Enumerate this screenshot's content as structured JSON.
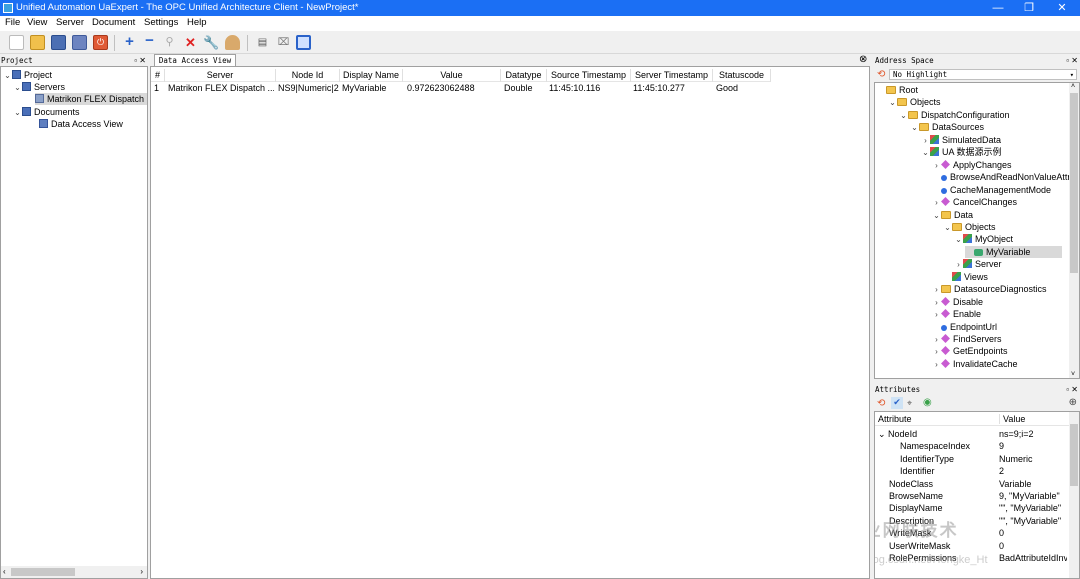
{
  "window": {
    "title": "Unified Automation UaExpert - The OPC Unified Architecture Client - NewProject*",
    "min": "—",
    "max": "❐",
    "close": "✕"
  },
  "menu": [
    "File",
    "View",
    "Server",
    "Document",
    "Settings",
    "Help"
  ],
  "project_panel": {
    "header": "Project",
    "items": [
      {
        "label": "Project",
        "level": 0,
        "expanded": true,
        "icon": "project-icon"
      },
      {
        "label": "Servers",
        "level": 1,
        "expanded": true,
        "icon": "servers-folder-icon"
      },
      {
        "label": "Matrikon FLEX Dispatch",
        "level": 2,
        "icon": "server-icon",
        "selected": true
      },
      {
        "label": "Documents",
        "level": 1,
        "expanded": true,
        "icon": "documents-folder-icon"
      },
      {
        "label": "Data Access View",
        "level": 2,
        "icon": "document-icon"
      }
    ]
  },
  "data_access_view": {
    "tab_label": "Data Access View",
    "columns": [
      "#",
      "Server",
      "Node Id",
      "Display Name",
      "Value",
      "Datatype",
      "Source Timestamp",
      "Server Timestamp",
      "Statuscode"
    ],
    "rows": [
      [
        "1",
        "Matrikon FLEX Dispatch ...",
        "NS9|Numeric|2",
        "MyVariable",
        "0.972623062488",
        "Double",
        "11:45:10.116",
        "11:45:10.277",
        "Good"
      ]
    ]
  },
  "address_space": {
    "header": "Address Space",
    "highlight": "No Highlight",
    "nodes": [
      {
        "label": "Root",
        "level": 0,
        "arrow": "",
        "icon": "folder"
      },
      {
        "label": "Objects",
        "level": 1,
        "arrow": "v",
        "icon": "folder"
      },
      {
        "label": "DispatchConfiguration",
        "level": 2,
        "arrow": "v",
        "icon": "folder"
      },
      {
        "label": "DataSources",
        "level": 3,
        "arrow": "v",
        "icon": "folder"
      },
      {
        "label": "SimulatedData",
        "level": 4,
        "arrow": ">",
        "icon": "obj"
      },
      {
        "label": "UA 数据源示例",
        "level": 4,
        "arrow": "v",
        "icon": "obj"
      },
      {
        "label": "ApplyChanges",
        "level": 5,
        "arrow": ">",
        "icon": "meth"
      },
      {
        "label": "BrowseAndReadNonValueAttri",
        "level": 5,
        "arrow": "",
        "icon": "var"
      },
      {
        "label": "CacheManagementMode",
        "level": 5,
        "arrow": "",
        "icon": "var"
      },
      {
        "label": "CancelChanges",
        "level": 5,
        "arrow": ">",
        "icon": "meth"
      },
      {
        "label": "Data",
        "level": 5,
        "arrow": "v",
        "icon": "folder"
      },
      {
        "label": "Objects",
        "level": 6,
        "arrow": "v",
        "icon": "folder"
      },
      {
        "label": "MyObject",
        "level": 7,
        "arrow": "v",
        "icon": "obj"
      },
      {
        "label": "MyVariable",
        "level": 8,
        "arrow": "",
        "icon": "varg",
        "selected": true
      },
      {
        "label": "Server",
        "level": 7,
        "arrow": ">",
        "icon": "obj"
      },
      {
        "label": "Views",
        "level": 6,
        "arrow": "",
        "icon": "obj"
      },
      {
        "label": "DatasourceDiagnostics",
        "level": 5,
        "arrow": ">",
        "icon": "folder"
      },
      {
        "label": "Disable",
        "level": 5,
        "arrow": ">",
        "icon": "meth"
      },
      {
        "label": "Enable",
        "level": 5,
        "arrow": ">",
        "icon": "meth"
      },
      {
        "label": "EndpointUrl",
        "level": 5,
        "arrow": "",
        "icon": "var"
      },
      {
        "label": "FindServers",
        "level": 5,
        "arrow": ">",
        "icon": "meth"
      },
      {
        "label": "GetEndpoints",
        "level": 5,
        "arrow": ">",
        "icon": "meth"
      },
      {
        "label": "InvalidateCache",
        "level": 5,
        "arrow": ">",
        "icon": "meth"
      }
    ]
  },
  "attributes": {
    "header": "Attributes",
    "col_attribute": "Attribute",
    "col_value": "Value",
    "rows": [
      {
        "k": "NodeId",
        "v": "ns=9;i=2",
        "indent": 0,
        "arrow": "v"
      },
      {
        "k": "NamespaceIndex",
        "v": "9",
        "indent": 2,
        "arrow": ""
      },
      {
        "k": "IdentifierType",
        "v": "Numeric",
        "indent": 2,
        "arrow": ""
      },
      {
        "k": "Identifier",
        "v": "2",
        "indent": 2,
        "arrow": ""
      },
      {
        "k": "NodeClass",
        "v": "Variable",
        "indent": 1,
        "arrow": ""
      },
      {
        "k": "BrowseName",
        "v": "9, \"MyVariable\"",
        "indent": 1,
        "arrow": ""
      },
      {
        "k": "DisplayName",
        "v": "\"\", \"MyVariable\"",
        "indent": 1,
        "arrow": ""
      },
      {
        "k": "Description",
        "v": "\"\", \"MyVariable\"",
        "indent": 1,
        "arrow": ""
      },
      {
        "k": "WriteMask",
        "v": "0",
        "indent": 1,
        "arrow": ""
      },
      {
        "k": "UserWriteMask",
        "v": "0",
        "indent": 1,
        "arrow": ""
      },
      {
        "k": "RolePermissions",
        "v": "BadAttributeIdInv",
        "indent": 1,
        "arrow": ""
      }
    ]
  },
  "watermark": {
    "text": "工业网联技术",
    "url": "https://blog.csdn.net/Hongke_Ht"
  }
}
